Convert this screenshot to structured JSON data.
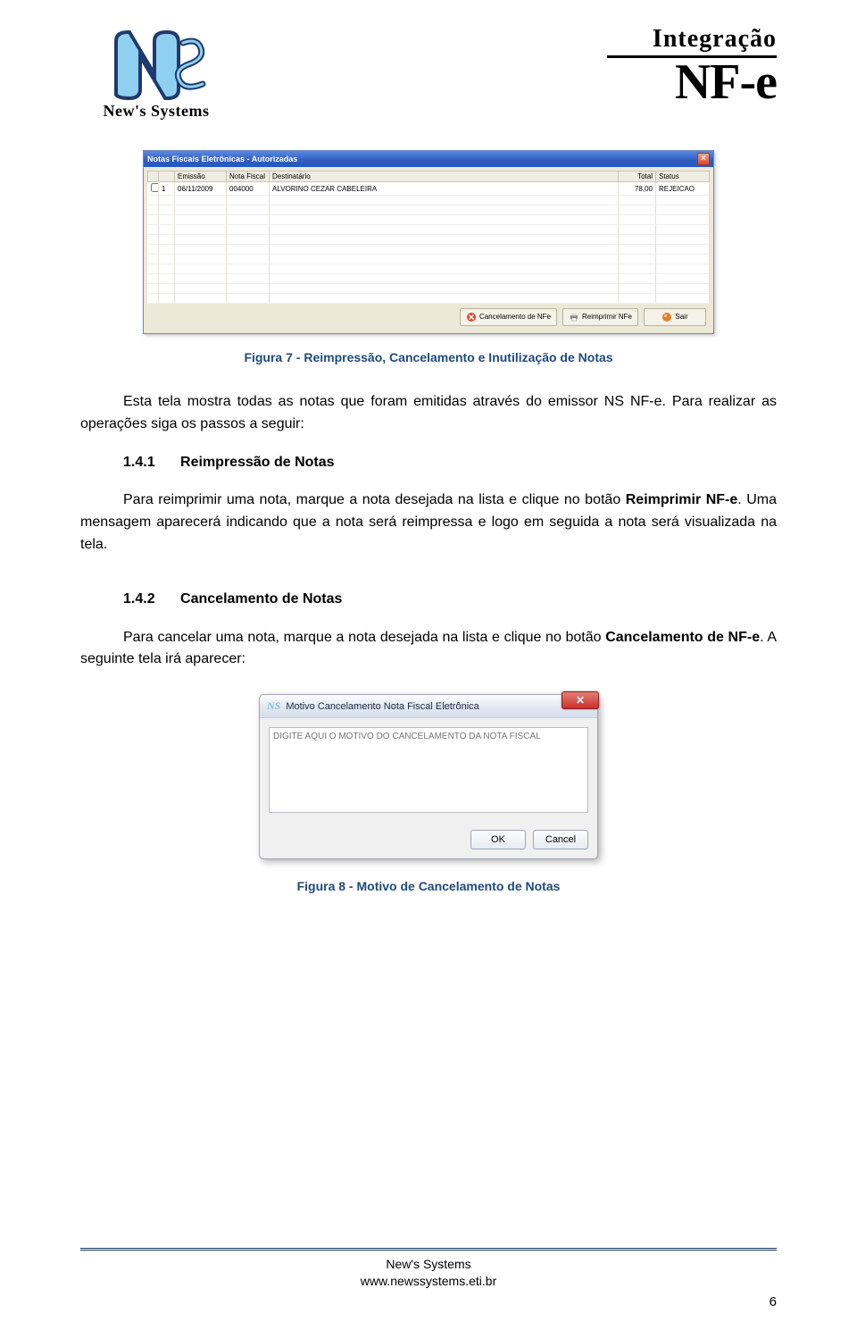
{
  "header": {
    "logo_left_text": "New's Systems",
    "logo_right_l1": "Integração",
    "logo_right_l2": "NF-e"
  },
  "window1": {
    "title": "Notas Fiscais Eletrônicas - Autorizadas",
    "columns": {
      "c0": "",
      "c1": "",
      "c2": "Emissão",
      "c3": "Nota Fiscal",
      "c4": "Destinatário",
      "c5": "Total",
      "c6": "Status"
    },
    "row": {
      "n": "1",
      "emissao": "06/11/2009",
      "nf": "004000",
      "dest": "ALVORINO CEZAR CABELEIRA",
      "total": "78,00",
      "status": "REJEICAO"
    },
    "buttons": {
      "b1": "Cancelamento de NFe",
      "b2": "Reimprimir NFe",
      "b3": "Sair"
    }
  },
  "fig7_caption": "Figura 7 - Reimpressão, Cancelamento e Inutilização de Notas",
  "intro_p1": "Esta tela mostra todas as notas que foram emitidas através do emissor NS NF-e. Para realizar as operações siga os passos a seguir:",
  "sec141_num": "1.4.1",
  "sec141_title": "Reimpressão de Notas",
  "sec141_body_a": "Para reimprimir uma nota, marque a nota desejada na lista e clique no botão ",
  "sec141_body_bold": "Reimprimir NF-e",
  "sec141_body_b": ". Uma mensagem aparecerá indicando que a nota será reimpressa e logo em seguida a nota será visualizada na tela.",
  "sec142_num": "1.4.2",
  "sec142_title": "Cancelamento de Notas",
  "sec142_body_a": "Para cancelar uma nota, marque a nota desejada na lista e clique no botão ",
  "sec142_body_bold": "Cancelamento de NF-e",
  "sec142_body_b": ". A seguinte tela irá aparecer:",
  "window2": {
    "title": "Motivo Cancelamento Nota Fiscal Eletrônica",
    "placeholder": "DIGITE AQUI O MOTIVO DO CANCELAMENTO DA NOTA FISCAL",
    "ok": "OK",
    "cancel": "Cancel"
  },
  "fig8_caption": "Figura 8 - Motivo de Cancelamento de Notas",
  "footer": {
    "l1": "New's Systems",
    "l2": "www.newssystems.eti.br",
    "page": "6"
  }
}
